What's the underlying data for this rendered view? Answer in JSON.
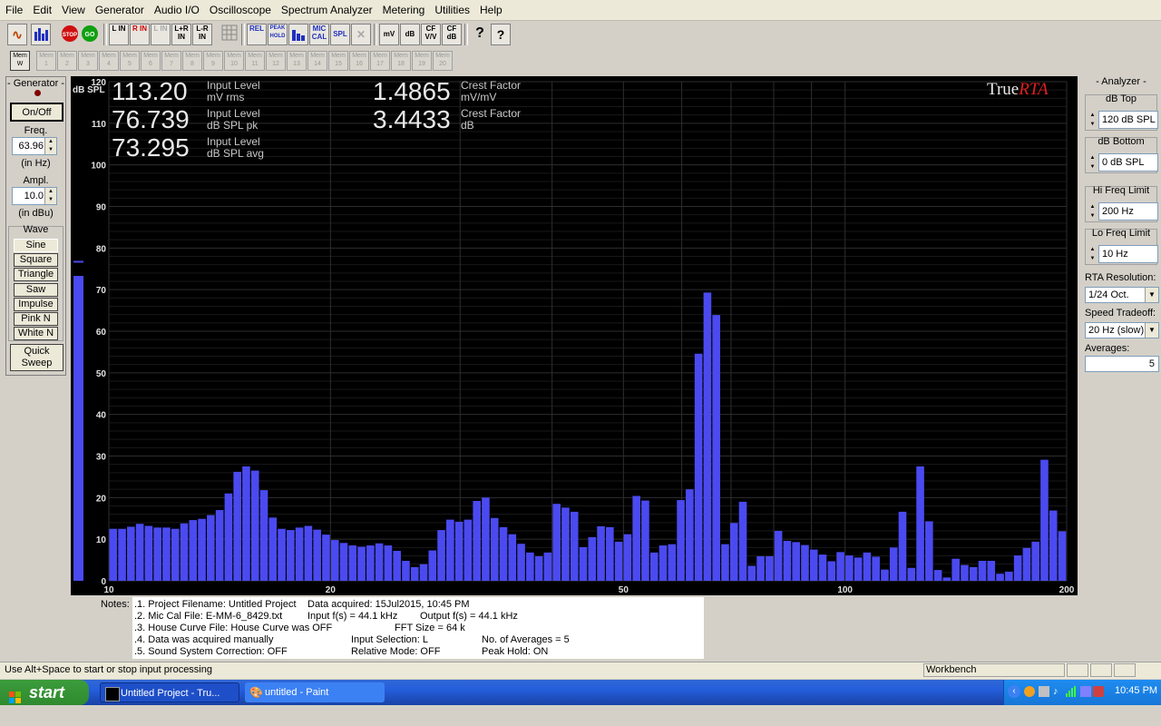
{
  "menu": [
    "File",
    "Edit",
    "View",
    "Generator",
    "Audio I/O",
    "Oscilloscope",
    "Spectrum Analyzer",
    "Metering",
    "Utilities",
    "Help"
  ],
  "toolbar": {
    "buttons": [
      "L IN",
      "R IN",
      "L IN",
      "L+R IN",
      "L-R IN",
      "REL",
      "PEAK HOLD",
      "MIC CAL",
      "SPL",
      "mV",
      "dB",
      "CF V/V",
      "CF dB",
      "?",
      "?"
    ]
  },
  "mem": {
    "active": "Mem W",
    "slots": [
      "1",
      "2",
      "3",
      "4",
      "5",
      "6",
      "7",
      "8",
      "9",
      "10",
      "11",
      "12",
      "13",
      "14",
      "15",
      "16",
      "17",
      "18",
      "19",
      "20"
    ],
    "prefix": "Mem"
  },
  "generator": {
    "title": "- Generator -",
    "onoff": "On/Off",
    "freq_label": "Freq.",
    "freq_value": "63.96",
    "freq_unit": "(in Hz)",
    "ampl_label": "Ampl.",
    "ampl_value": "10.0",
    "ampl_unit": "(in dBu)",
    "wave_label": "Wave",
    "waves": [
      "Sine",
      "Square",
      "Triangle",
      "Saw",
      "Impulse",
      "Pink N",
      "White N"
    ],
    "quick_sweep": "Quick Sweep"
  },
  "readouts": [
    {
      "value": "113.20",
      "line1": "Input Level",
      "line2": "mV rms"
    },
    {
      "value": "76.739",
      "line1": "Input Level",
      "line2": "dB SPL pk"
    },
    {
      "value": "73.295",
      "line1": "Input Level",
      "line2": "dB SPL avg"
    },
    {
      "value": "1.4865",
      "line1": "Crest Factor",
      "line2": "mV/mV"
    },
    {
      "value": "3.4433",
      "line1": "Crest Factor",
      "line2": "dB"
    }
  ],
  "logo": {
    "part1": "True",
    "part2": "RTA"
  },
  "chart_data": {
    "type": "bar",
    "ylabel": "dB SPL",
    "ylim": [
      0,
      120
    ],
    "yticks": [
      0,
      10,
      20,
      30,
      40,
      50,
      60,
      70,
      80,
      90,
      100,
      110,
      120
    ],
    "x_scale": "log",
    "xlim": [
      10,
      200
    ],
    "xtick_labels": [
      {
        "v": 10,
        "t": "10"
      },
      {
        "v": 20,
        "t": "20"
      },
      {
        "v": 50,
        "t": "50"
      },
      {
        "v": 100,
        "t": "100"
      },
      {
        "v": 200,
        "t": "200"
      }
    ],
    "bar_color": "#4a4af0",
    "grid": true,
    "level_meter": {
      "value": 73.3,
      "peak": 76.7
    },
    "values": [
      12.5,
      12.5,
      13,
      13.7,
      13.2,
      12.8,
      12.8,
      12.5,
      13.8,
      14.6,
      14.9,
      15.8,
      17,
      21,
      26.2,
      27.5,
      26.5,
      21.8,
      15.2,
      12.5,
      12.2,
      12.8,
      13.2,
      12.3,
      11.1,
      9.8,
      9.1,
      8.5,
      8.2,
      8.5,
      9,
      8.5,
      7.2,
      4.8,
      3.3,
      4,
      7.3,
      12.2,
      14.7,
      14.2,
      14.7,
      19.2,
      20,
      15.1,
      12.9,
      11.2,
      8.9,
      6.8,
      5.9,
      6.8,
      18.5,
      17.6,
      16.6,
      8.1,
      10.5,
      13.1,
      12.9,
      9.4,
      11.2,
      20.4,
      19.3,
      6.8,
      8.5,
      8.8,
      19.4,
      22,
      54.6,
      69.3,
      63.9,
      8.8,
      13.9,
      19,
      3.6,
      5.9,
      5.9,
      12,
      9.6,
      9.3,
      8.6,
      7.5,
      6.3,
      4.7,
      6.9,
      6.1,
      5.6,
      6.8,
      5.8,
      2.7,
      8,
      16.6,
      3.1,
      27.5,
      14.3,
      2.6,
      0.8,
      5.3,
      3.8,
      3.3,
      4.8,
      4.8,
      1.7,
      2.2,
      6.1,
      7.9,
      9.4,
      29.1,
      16.9,
      11.9
    ]
  },
  "analyzer": {
    "title": "- Analyzer -",
    "db_top_label": "dB Top",
    "db_top": "120 dB SPL",
    "db_bottom_label": "dB Bottom",
    "db_bottom": "0 dB SPL",
    "hi_freq_label": "Hi Freq Limit",
    "hi_freq": "200 Hz",
    "lo_freq_label": "Lo Freq Limit",
    "lo_freq": "10 Hz",
    "resolution_label": "RTA Resolution:",
    "resolution": "1/24 Oct.",
    "speed_label": "Speed Tradeoff:",
    "speed": "20 Hz (slow)",
    "averages_label": "Averages:",
    "averages": "5"
  },
  "notes": {
    "label": "Notes:",
    "l1a": ".1. Project Filename: Untitled Project",
    "l1b": "Data acquired: 15Jul2015, 10:45 PM",
    "l2a": ".2. Mic Cal File: E-MM-6_8429.txt",
    "l2b": "Input f(s) = 44.1 kHz",
    "l2c": "Output f(s) = 44.1 kHz",
    "l3a": ".3. House Curve File: House Curve was OFF",
    "l3b": "FFT Size = 64 k",
    "l4a": ".4. Data was acquired manually",
    "l4b": "Input Selection: L",
    "l4c": "No. of Averages = 5",
    "l5a": ".5. Sound System Correction: OFF",
    "l5b": "Relative Mode:  OFF",
    "l5c": "Peak Hold: ON"
  },
  "status": {
    "hint": "Use Alt+Space to start or stop input processing",
    "mode": "Workbench"
  },
  "taskbar": {
    "start": "start",
    "tasks": [
      "Untitled Project - Tru...",
      "untitled - Paint"
    ],
    "clock": "10:45 PM"
  }
}
